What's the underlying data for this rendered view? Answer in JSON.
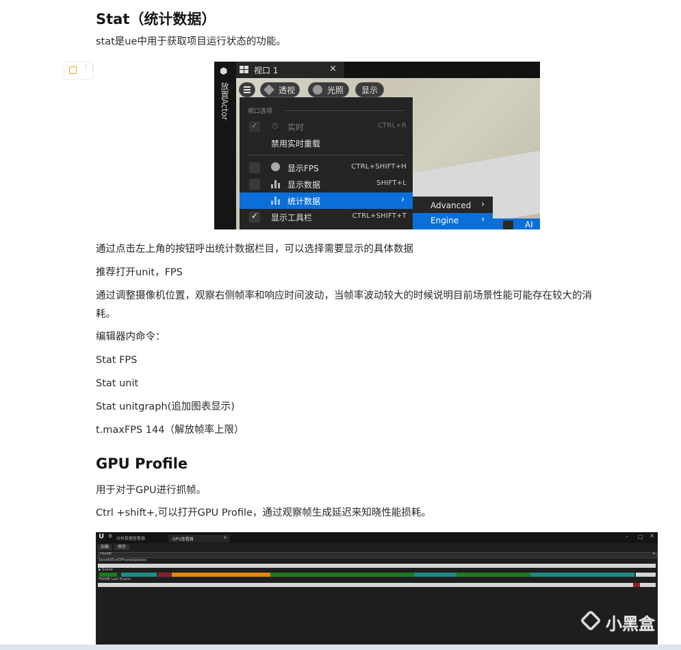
{
  "heading1": "Stat（统计数据）",
  "intro": "stat是ue中用于获取项目运行状态的功能。",
  "image_tool_icon": "image-icon",
  "ue": {
    "side_label": "放置Actor",
    "tab_title": "视口 1",
    "tab_close": "×",
    "toolbar": {
      "menu_icon": "hamburger-icon",
      "perspective": "透视",
      "lighting": "光照",
      "show": "显示"
    },
    "menu": {
      "section": "视口选项",
      "items": [
        {
          "label": "实时",
          "shortcut": "CTRL+R",
          "checked": true,
          "disabled": true
        },
        {
          "label": "禁用实时重载",
          "shortcut": ""
        },
        {
          "label": "显示FPS",
          "shortcut": "CTRL+SHIFT+H",
          "checked": false
        },
        {
          "label": "显示数据",
          "shortcut": "SHIFT+L",
          "checked": false
        },
        {
          "label": "统计数据",
          "shortcut": "",
          "highlighted": true
        },
        {
          "label": "显示工具栏",
          "shortcut": "CTRL+SHIFT+T",
          "checked": true
        }
      ]
    },
    "submenu": [
      "Advanced",
      "Engine"
    ],
    "partial_label": "AI"
  },
  "para1": "通过点击左上角的按钮呼出统计数据栏目，可以选择需要显示的具体数据",
  "para2": "推荐打开unit，FPS",
  "para3_line1": "通过调整摄像机位置，观察右侧帧率和响应时间波动，当帧率波动较大的时候说明目前场景性能可能存在较大的消",
  "para3_line2": "耗。",
  "para4": "编辑器内命令：",
  "cmd1": "Stat FPS",
  "cmd2": "Stat unit",
  "cmd3": "Stat unitgraph(追加图表显示)",
  "cmd4": "t.maxFPS 144（解放帧率上限）",
  "heading2": "GPU Profile",
  "para5": "用于对于GPU进行抓帧。",
  "para6": "Ctrl +shift+,可以打开GPU Profile，通过观察帧生成延迟来知晓性能损耗。",
  "gpu": {
    "app_title": "分析数据查看器",
    "tab": "GPU查看器",
    "tab_close": "×",
    "btn_load": "加载",
    "btn_save": "保存",
    "dropdown": "FRAME",
    "row1": "SendAllEndOfFrameUpdates",
    "row2": "▶ Scene",
    "row3": "FRAME Leaf Events",
    "win_controls": [
      "–",
      "□",
      "×"
    ]
  },
  "watermark": "小黑盒",
  "colors": {
    "menu_highlight": "#0a6fd8",
    "bar_orange": "#e8860a",
    "bar_green": "#1d7a1d",
    "bar_teal": "#1a8d84",
    "bar_red": "#8a1f2c"
  }
}
